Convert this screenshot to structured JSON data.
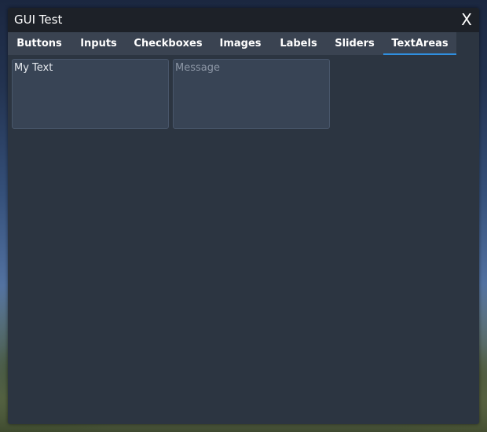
{
  "window": {
    "title": "GUI Test",
    "close_label": "X"
  },
  "tabs": [
    {
      "label": "Buttons",
      "active": false
    },
    {
      "label": "Inputs",
      "active": false
    },
    {
      "label": "Checkboxes",
      "active": false
    },
    {
      "label": "Images",
      "active": false
    },
    {
      "label": "Labels",
      "active": false
    },
    {
      "label": "Sliders",
      "active": false
    },
    {
      "label": "TextAreas",
      "active": true
    }
  ],
  "textareas": [
    {
      "value": "My Text",
      "placeholder": ""
    },
    {
      "value": "",
      "placeholder": "Message"
    }
  ],
  "colors": {
    "accent": "#2f8fe0",
    "window_bg": "#2c3541",
    "titlebar_bg": "#1d2128",
    "tabbar_bg": "#3a4351"
  }
}
